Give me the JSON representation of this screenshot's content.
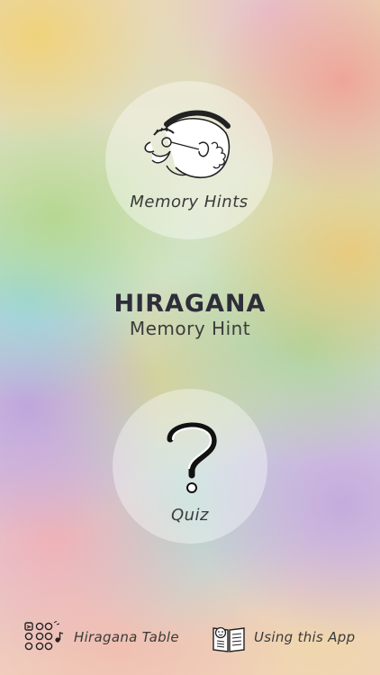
{
  "main": {
    "memory_hints_label": "Memory Hints",
    "quiz_label": "Quiz"
  },
  "title": {
    "heading": "HIRAGANA",
    "subheading": "Memory Hint"
  },
  "footer": {
    "table_label": "Hiragana Table",
    "guide_label": "Using this App"
  },
  "icons": {
    "memory_hints": "old-man-face-icon",
    "quiz": "question-mark-icon",
    "table": "kana-grid-icon",
    "guide": "book-icon"
  }
}
